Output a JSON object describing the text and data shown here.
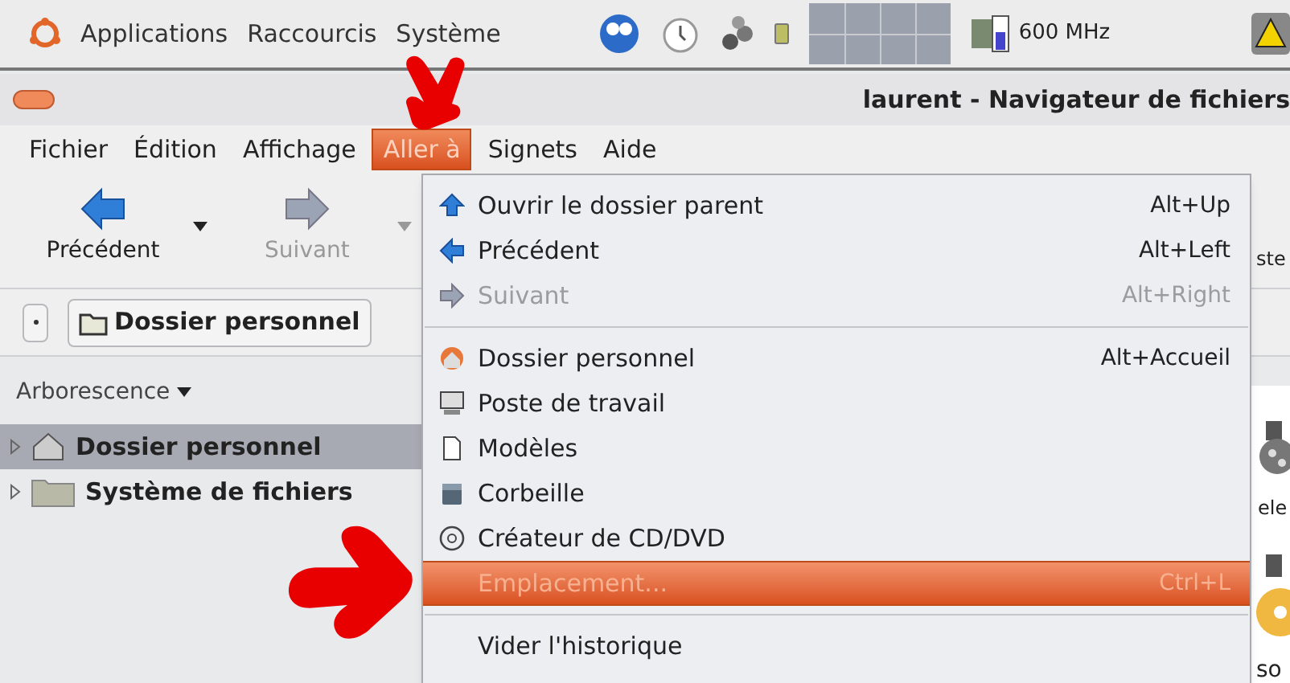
{
  "top_panel": {
    "menus": [
      "Applications",
      "Raccourcis",
      "Système"
    ],
    "cpu_reading": "600 MHz"
  },
  "window": {
    "title": "laurent - Navigateur de fichiers"
  },
  "menubar": [
    {
      "label": "Fichier",
      "selected": false
    },
    {
      "label": "Édition",
      "selected": false
    },
    {
      "label": "Affichage",
      "selected": false
    },
    {
      "label": "Aller à",
      "selected": true
    },
    {
      "label": "Signets",
      "selected": false
    },
    {
      "label": "Aide",
      "selected": false
    }
  ],
  "toolbar": [
    {
      "label": "Précédent",
      "disabled": false
    },
    {
      "label": "Suivant",
      "disabled": true
    }
  ],
  "location": {
    "button": "Dossier personnel"
  },
  "side_pane": {
    "header": "Arborescence",
    "tree": [
      {
        "label": "Dossier personnel",
        "selected": true
      },
      {
        "label": "Système de fichiers",
        "selected": false
      }
    ]
  },
  "content_partial": [
    "ste",
    "ele",
    "so"
  ],
  "go_menu": [
    {
      "kind": "item",
      "label": "Ouvrir le dossier parent",
      "shortcut": "Alt+Up",
      "disabled": false,
      "selected": false
    },
    {
      "kind": "item",
      "label": "Précédent",
      "shortcut": "Alt+Left",
      "disabled": false,
      "selected": false
    },
    {
      "kind": "item",
      "label": "Suivant",
      "shortcut": "Alt+Right",
      "disabled": true,
      "selected": false
    },
    {
      "kind": "separator"
    },
    {
      "kind": "item",
      "label": "Dossier personnel",
      "shortcut": "Alt+Accueil",
      "disabled": false,
      "selected": false
    },
    {
      "kind": "item",
      "label": "Poste de travail",
      "disabled": false,
      "selected": false
    },
    {
      "kind": "item",
      "label": "Modèles",
      "disabled": false,
      "selected": false
    },
    {
      "kind": "item",
      "label": "Corbeille",
      "disabled": false,
      "selected": false
    },
    {
      "kind": "item",
      "label": "Créateur de CD/DVD",
      "disabled": false,
      "selected": false
    },
    {
      "kind": "item",
      "label": "Emplacement...",
      "shortcut": "Ctrl+L",
      "disabled": false,
      "selected": true
    },
    {
      "kind": "separator"
    },
    {
      "kind": "item",
      "label": "Vider l'historique",
      "disabled": false,
      "selected": false
    }
  ]
}
